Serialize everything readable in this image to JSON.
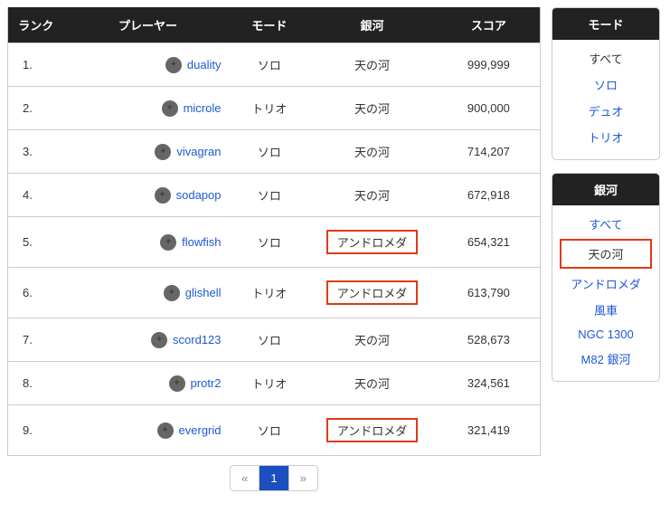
{
  "headers": {
    "rank": "ランク",
    "player": "プレーヤー",
    "mode": "モード",
    "galaxy": "銀河",
    "score": "スコア"
  },
  "rows": [
    {
      "rank": "1.",
      "player": "duality",
      "mode": "ソロ",
      "galaxy": "天の河",
      "score": "999,999",
      "hl": false
    },
    {
      "rank": "2.",
      "player": "microle",
      "mode": "トリオ",
      "galaxy": "天の河",
      "score": "900,000",
      "hl": false
    },
    {
      "rank": "3.",
      "player": "vivagran",
      "mode": "ソロ",
      "galaxy": "天の河",
      "score": "714,207",
      "hl": false
    },
    {
      "rank": "4.",
      "player": "sodapop",
      "mode": "ソロ",
      "galaxy": "天の河",
      "score": "672,918",
      "hl": false
    },
    {
      "rank": "5.",
      "player": "flowfish",
      "mode": "ソロ",
      "galaxy": "アンドロメダ",
      "score": "654,321",
      "hl": true
    },
    {
      "rank": "6.",
      "player": "glishell",
      "mode": "トリオ",
      "galaxy": "アンドロメダ",
      "score": "613,790",
      "hl": true
    },
    {
      "rank": "7.",
      "player": "scord123",
      "mode": "ソロ",
      "galaxy": "天の河",
      "score": "528,673",
      "hl": false
    },
    {
      "rank": "8.",
      "player": "protr2",
      "mode": "トリオ",
      "galaxy": "天の河",
      "score": "324,561",
      "hl": false
    },
    {
      "rank": "9.",
      "player": "evergrid",
      "mode": "ソロ",
      "galaxy": "アンドロメダ",
      "score": "321,419",
      "hl": true
    }
  ],
  "pager": {
    "prev": "«",
    "page": "1",
    "next": "»"
  },
  "side": {
    "mode": {
      "title": "モード",
      "items": [
        {
          "label": "すべて",
          "current": true,
          "selected": false
        },
        {
          "label": "ソロ",
          "current": false,
          "selected": false
        },
        {
          "label": "デュオ",
          "current": false,
          "selected": false
        },
        {
          "label": "トリオ",
          "current": false,
          "selected": false
        }
      ]
    },
    "galaxy": {
      "title": "銀河",
      "items": [
        {
          "label": "すべて",
          "current": false,
          "selected": false
        },
        {
          "label": "天の河",
          "current": true,
          "selected": true
        },
        {
          "label": "アンドロメダ",
          "current": false,
          "selected": false
        },
        {
          "label": "風車",
          "current": false,
          "selected": false
        },
        {
          "label": "NGC 1300",
          "current": false,
          "selected": false
        },
        {
          "label": "M82 銀河",
          "current": false,
          "selected": false
        }
      ]
    }
  }
}
